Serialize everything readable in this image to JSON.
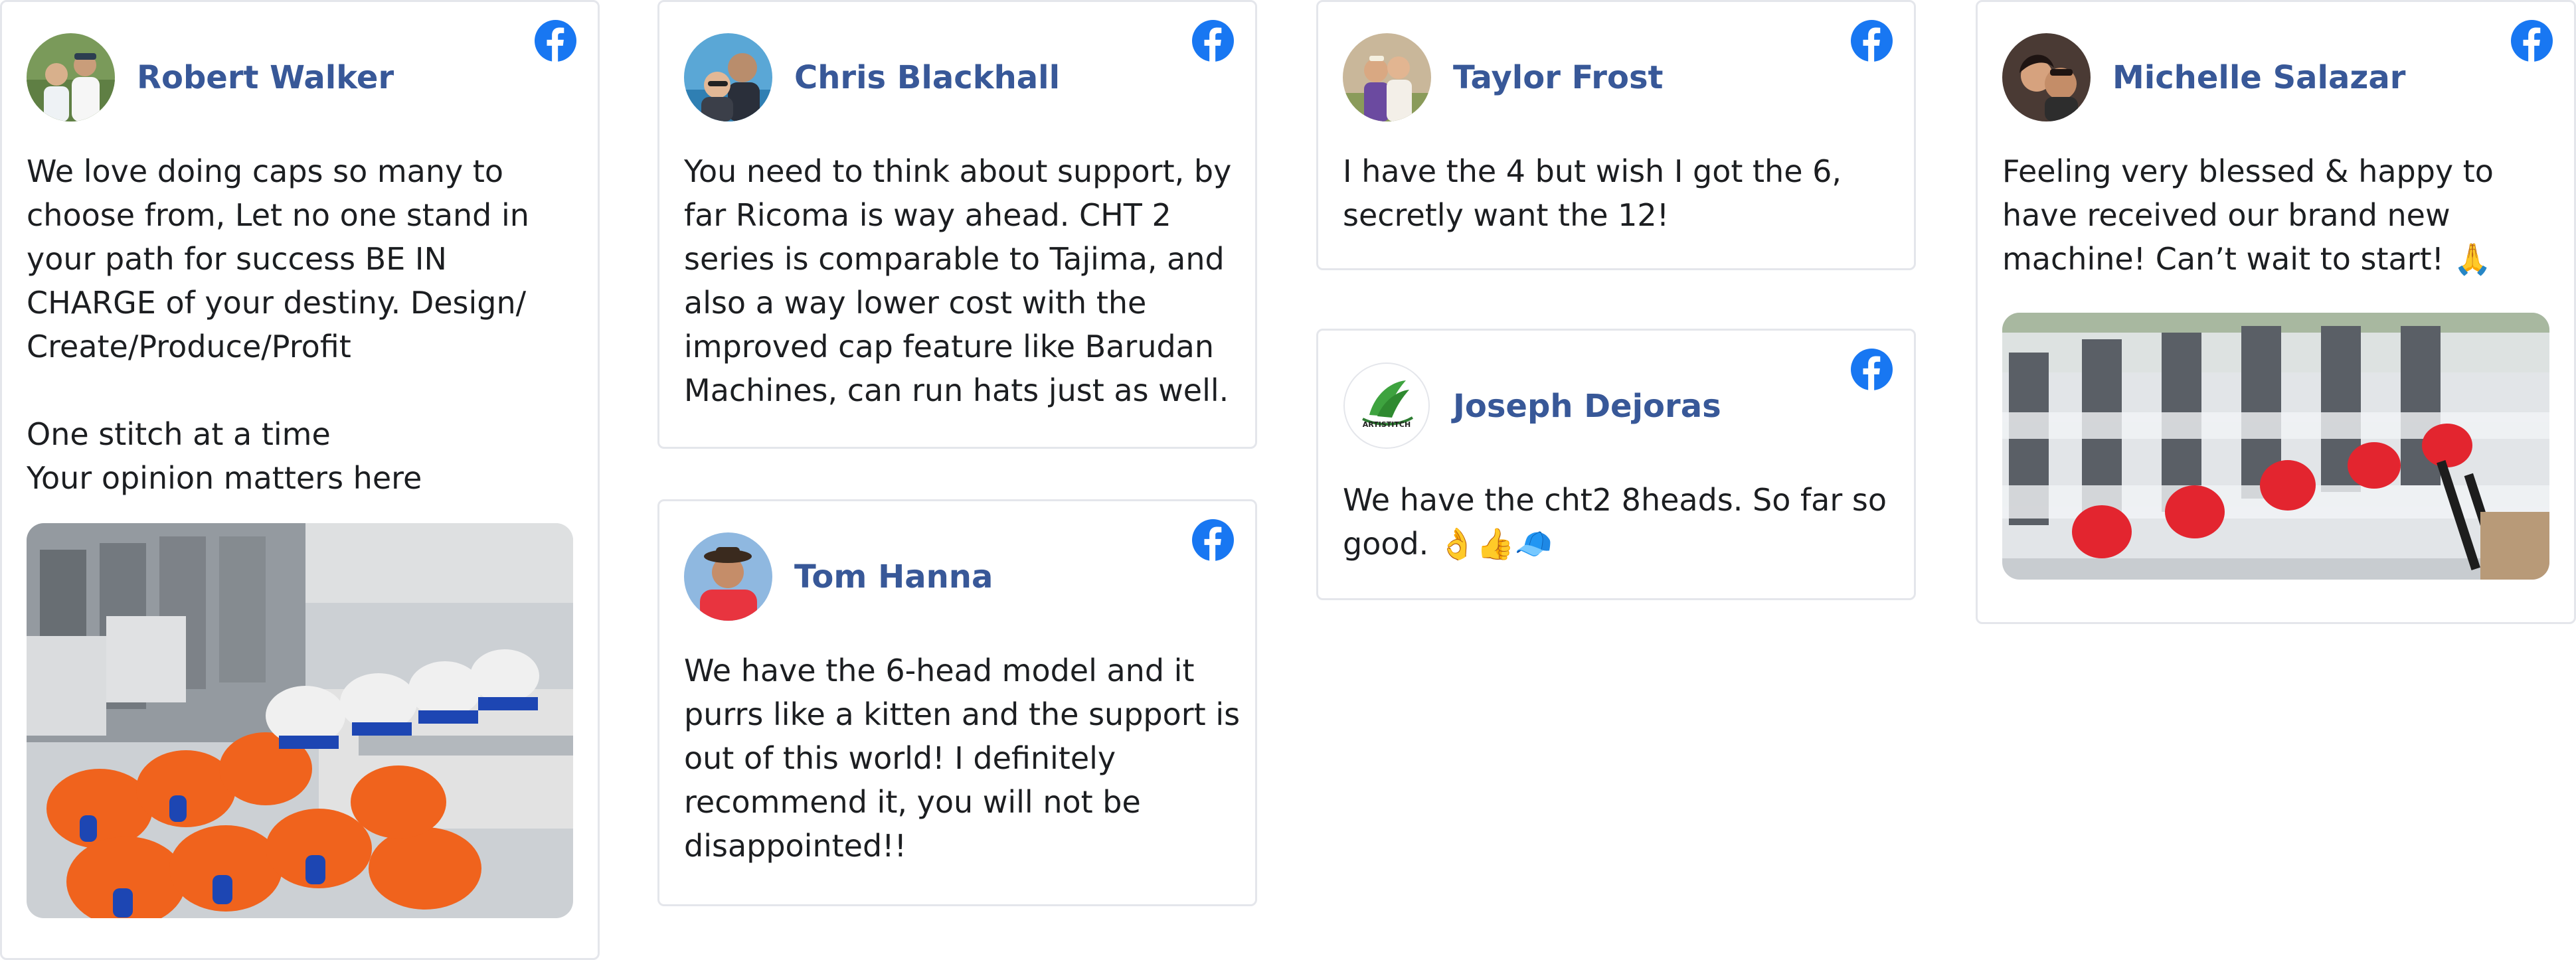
{
  "colors": {
    "name": "#385898",
    "facebook": "#1877f2",
    "text": "#1c1e21",
    "border": "#e4e6eb"
  },
  "reviews": [
    {
      "name": "Robert Walker",
      "text": "We love doing caps so many to choose from, Let no one stand in your path for success BE IN CHARGE of your destiny. Design/ Create/Produce/Profit\n\nOne stitch at a time\nYour opinion matters here",
      "source_icon": "facebook-icon",
      "photo": "embroidery-machines-with-orange-sc-caps"
    },
    {
      "name": "Chris Blackhall",
      "text": "You need to think about support, by far Ricoma is way ahead. CHT 2 series is comparable to Tajima, and also a way lower cost with the improved cap feature like Barudan Machines, can run hats just as well.",
      "source_icon": "facebook-icon"
    },
    {
      "name": "Tom Hanna",
      "text": "We have the 6-head model and it purrs like a kitten and the support is out of this world! I definitely recommend it, you will not be disappointed!!",
      "source_icon": "facebook-icon"
    },
    {
      "name": "Taylor Frost",
      "text": "I have the 4 but wish I got the 6, secretly want the 12!",
      "source_icon": "facebook-icon"
    },
    {
      "name": "Joseph Dejoras",
      "text": "We have the cht2 8heads. So far so good. 👌👍🧢",
      "source_icon": "facebook-icon",
      "avatar_logo_text": "ARTISTITCH"
    },
    {
      "name": "Michelle Salazar",
      "text": "Feeling very blessed & happy to have received our brand new machine! Can’t wait to start! 🙏",
      "source_icon": "facebook-icon",
      "photo": "wrapped-multi-head-embroidery-machine"
    }
  ]
}
